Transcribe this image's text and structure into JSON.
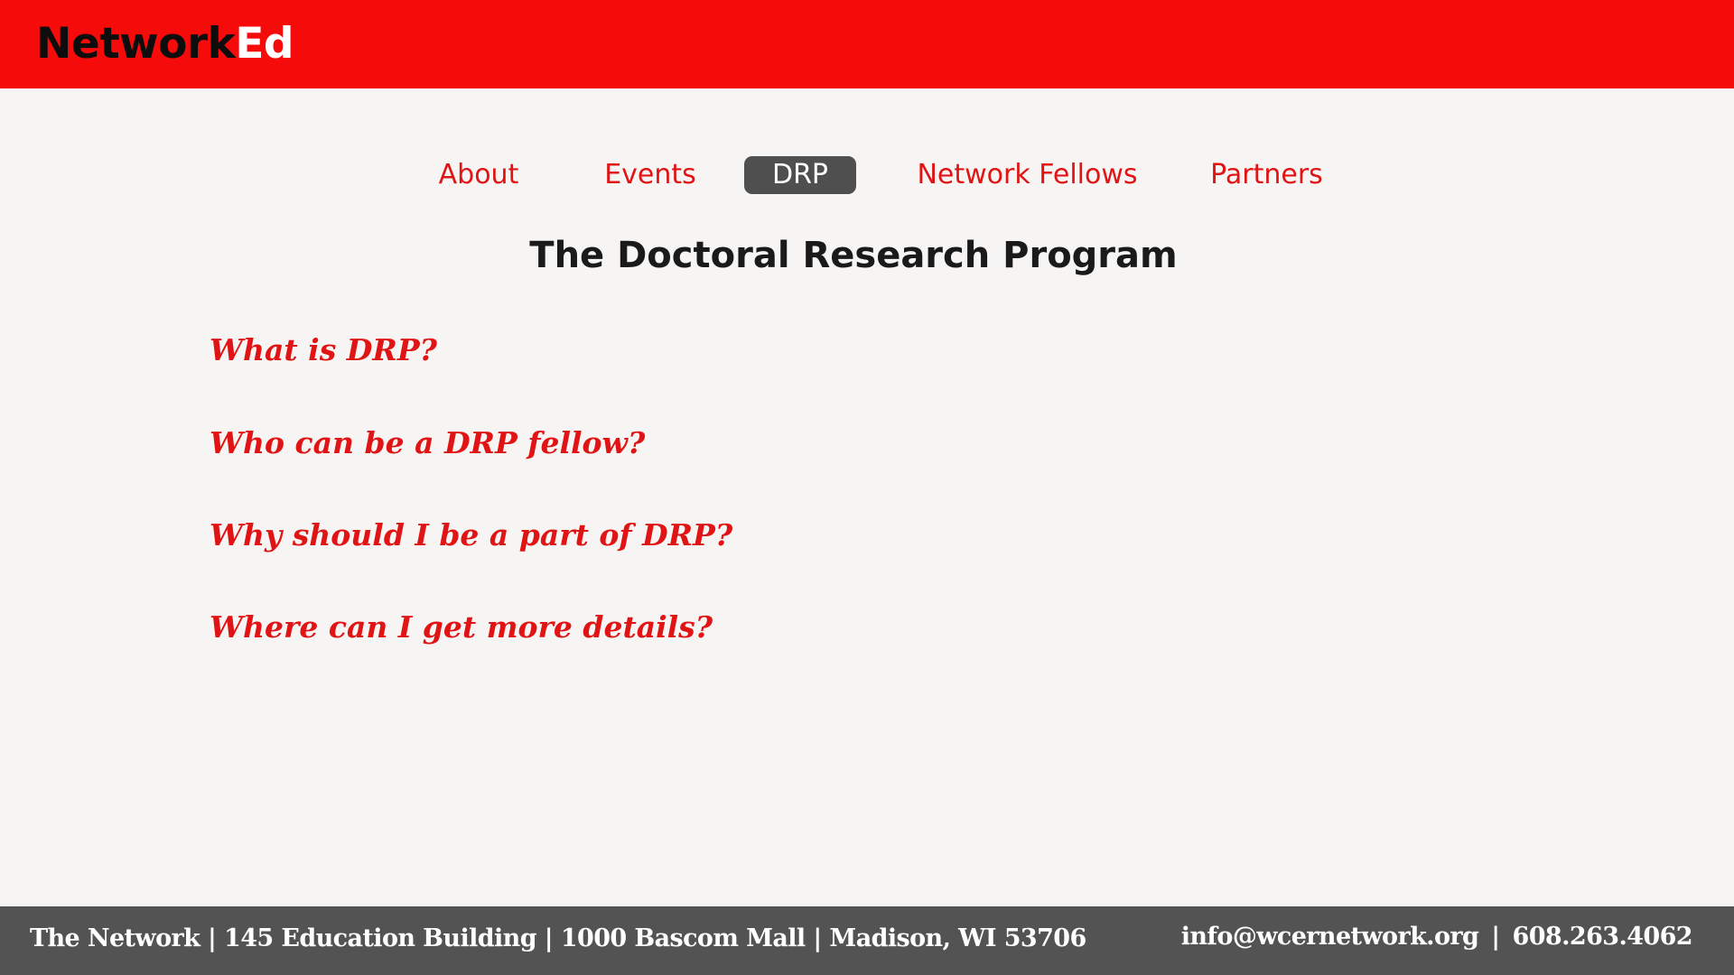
{
  "header": {
    "logo_part1": "Network",
    "logo_part2": "Ed",
    "background_color": "#f60b0b"
  },
  "nav": {
    "items": [
      {
        "label": "About",
        "active": false
      },
      {
        "label": "Events",
        "active": false
      },
      {
        "label": "DRP",
        "active": true
      },
      {
        "label": "Network Fellows",
        "active": false
      },
      {
        "label": "Partners",
        "active": false
      }
    ],
    "link_color": "#e01414",
    "active_background": "#4f4f4f"
  },
  "main": {
    "title": "The Doctoral Research Program",
    "questions": [
      "What is DRP?",
      "Who can be a DRP fellow?",
      "Why should I be a part of DRP?",
      "Where can I get more details?"
    ]
  },
  "footer": {
    "address": "The Network | 145 Education Building | 1000 Bascom Mall | Madison, WI 53706",
    "email": "info@wcernetwork.org",
    "separator": "|",
    "phone": "608.263.4062",
    "background_color": "#535353"
  }
}
